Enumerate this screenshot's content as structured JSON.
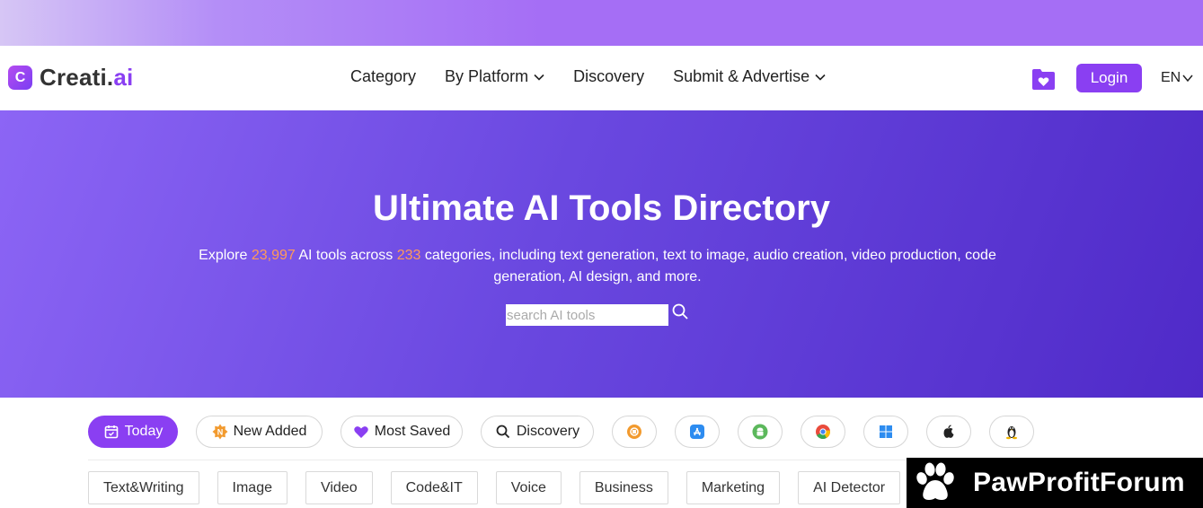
{
  "brand": {
    "name_main": "Creati.",
    "name_accent": "ai",
    "mark": "C"
  },
  "nav": {
    "items": [
      {
        "label": "Category",
        "has_dropdown": false
      },
      {
        "label": "By Platform",
        "has_dropdown": true
      },
      {
        "label": "Discovery",
        "has_dropdown": false
      },
      {
        "label": "Submit & Advertise",
        "has_dropdown": true
      }
    ],
    "login_label": "Login",
    "language": "EN"
  },
  "hero": {
    "title": "Ultimate AI Tools Directory",
    "desc_prefix": "Explore ",
    "tool_count": "23,997",
    "desc_mid": " AI tools across ",
    "category_count": "233",
    "desc_suffix": " categories, including text generation, text to image, audio creation, video production, code generation, AI design, and more.",
    "search_placeholder": "search AI tools"
  },
  "filters": [
    {
      "label": "Today",
      "icon": "calendar-icon",
      "active": true
    },
    {
      "label": "New Added",
      "icon": "new-badge-icon",
      "active": false
    },
    {
      "label": "Most Saved",
      "icon": "heart-icon",
      "active": false
    },
    {
      "label": "Discovery",
      "icon": "search-icon",
      "active": false
    }
  ],
  "platforms": [
    "chrome-extension-icon",
    "app-store-icon",
    "android-icon",
    "chrome-icon",
    "windows-icon",
    "apple-icon",
    "linux-icon"
  ],
  "categories": [
    "Text&Writing",
    "Image",
    "Video",
    "Code&IT",
    "Voice",
    "Business",
    "Marketing",
    "AI Detector"
  ],
  "watermark": {
    "text": "PawProfitForum"
  },
  "colors": {
    "accent": "#8a3ff2",
    "highlight": "#ff9a5a",
    "hero_start": "#8c65f5",
    "hero_end": "#4f2ac8"
  }
}
